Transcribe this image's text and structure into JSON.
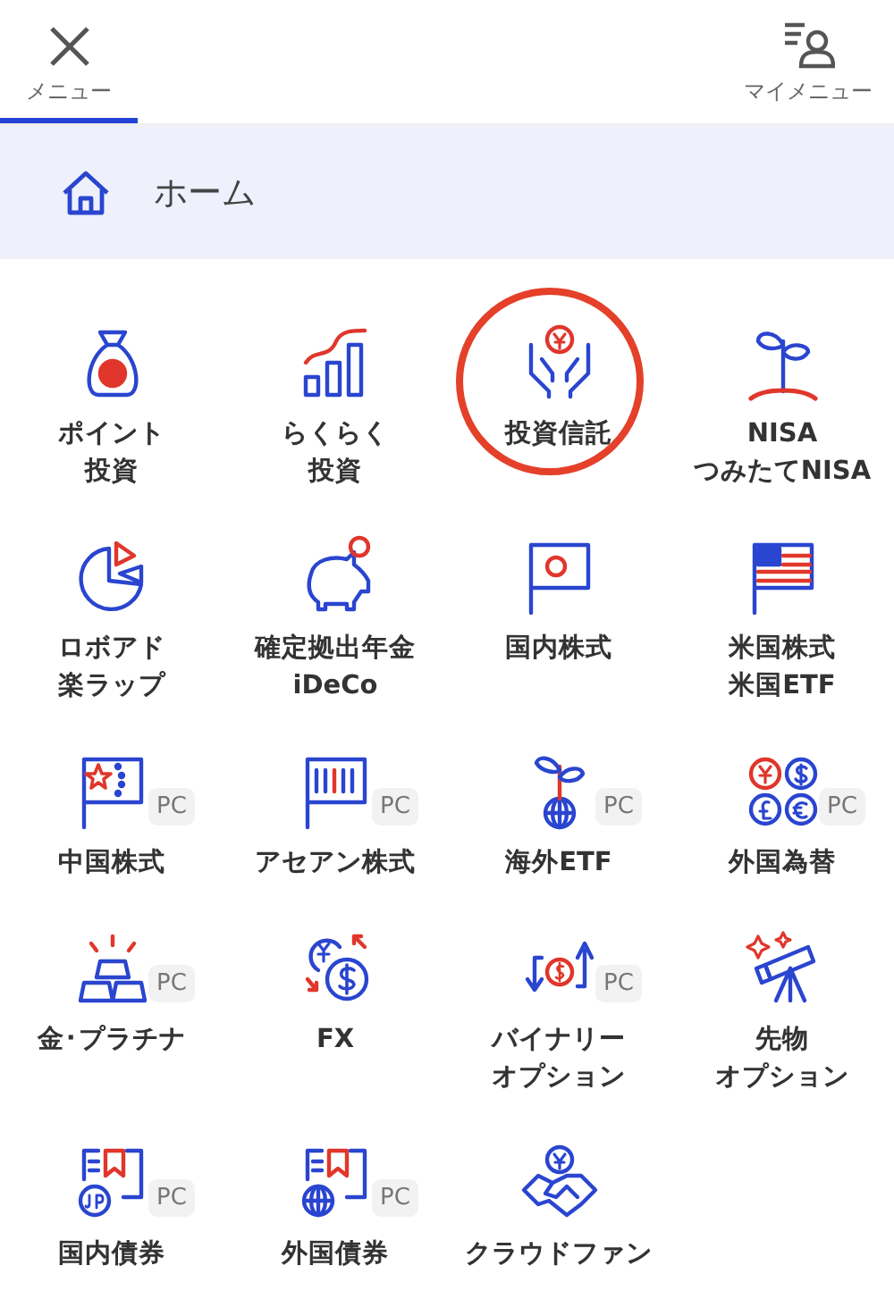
{
  "tabs": [
    {
      "label": "メニュー",
      "selected": true,
      "kind": "close"
    },
    {
      "label": "マイメニュー",
      "selected": false,
      "kind": "mymenu"
    }
  ],
  "home": {
    "label": "ホーム"
  },
  "items": [
    {
      "kind": "moneybag",
      "lines": [
        "ポイント",
        "投資"
      ],
      "highlighted": false
    },
    {
      "kind": "chart",
      "lines": [
        "らくらく",
        "投資"
      ],
      "highlighted": false
    },
    {
      "kind": "hands",
      "lines": [
        "投資信託"
      ],
      "highlighted": true
    },
    {
      "kind": "sprout",
      "lines": [
        "NISA",
        "つみたてNISA"
      ],
      "highlighted": false
    },
    {
      "kind": "pie",
      "lines": [
        "ロボアド",
        "楽ラップ"
      ],
      "highlighted": false
    },
    {
      "kind": "piggy",
      "lines": [
        "確定拠出年金",
        "iDeCo"
      ],
      "highlighted": false
    },
    {
      "kind": "flag-jp",
      "lines": [
        "国内株式"
      ],
      "highlighted": false
    },
    {
      "kind": "flag-us",
      "lines": [
        "米国株式",
        "米国ETF"
      ],
      "highlighted": false
    },
    {
      "kind": "flag-cn",
      "lines": [
        "中国株式"
      ],
      "badge": "PC",
      "highlighted": false
    },
    {
      "kind": "flag-asean",
      "lines": [
        "アセアン株式"
      ],
      "badge": "PC",
      "highlighted": false
    },
    {
      "kind": "globe-sprout",
      "lines": [
        "海外ETF"
      ],
      "badge": "PC",
      "highlighted": false
    },
    {
      "kind": "currencies",
      "lines": [
        "外国為替"
      ],
      "badge": "PC",
      "highlighted": false
    },
    {
      "kind": "gold",
      "lines": [
        "金･プラチナ"
      ],
      "badge": "PC",
      "highlighted": false
    },
    {
      "kind": "fx",
      "lines": [
        "FX"
      ],
      "highlighted": false
    },
    {
      "kind": "binary",
      "lines": [
        "バイナリー",
        "オプション"
      ],
      "badge": "PC",
      "highlighted": false
    },
    {
      "kind": "telescope",
      "lines": [
        "先物",
        "オプション"
      ],
      "highlighted": false
    },
    {
      "kind": "bond-jp",
      "lines": [
        "国内債券"
      ],
      "badge": "PC",
      "highlighted": false
    },
    {
      "kind": "bond-globe",
      "lines": [
        "外国債券"
      ],
      "badge": "PC",
      "highlighted": false
    },
    {
      "kind": "handshake",
      "lines": [
        "クラウドファン"
      ],
      "highlighted": false
    }
  ]
}
